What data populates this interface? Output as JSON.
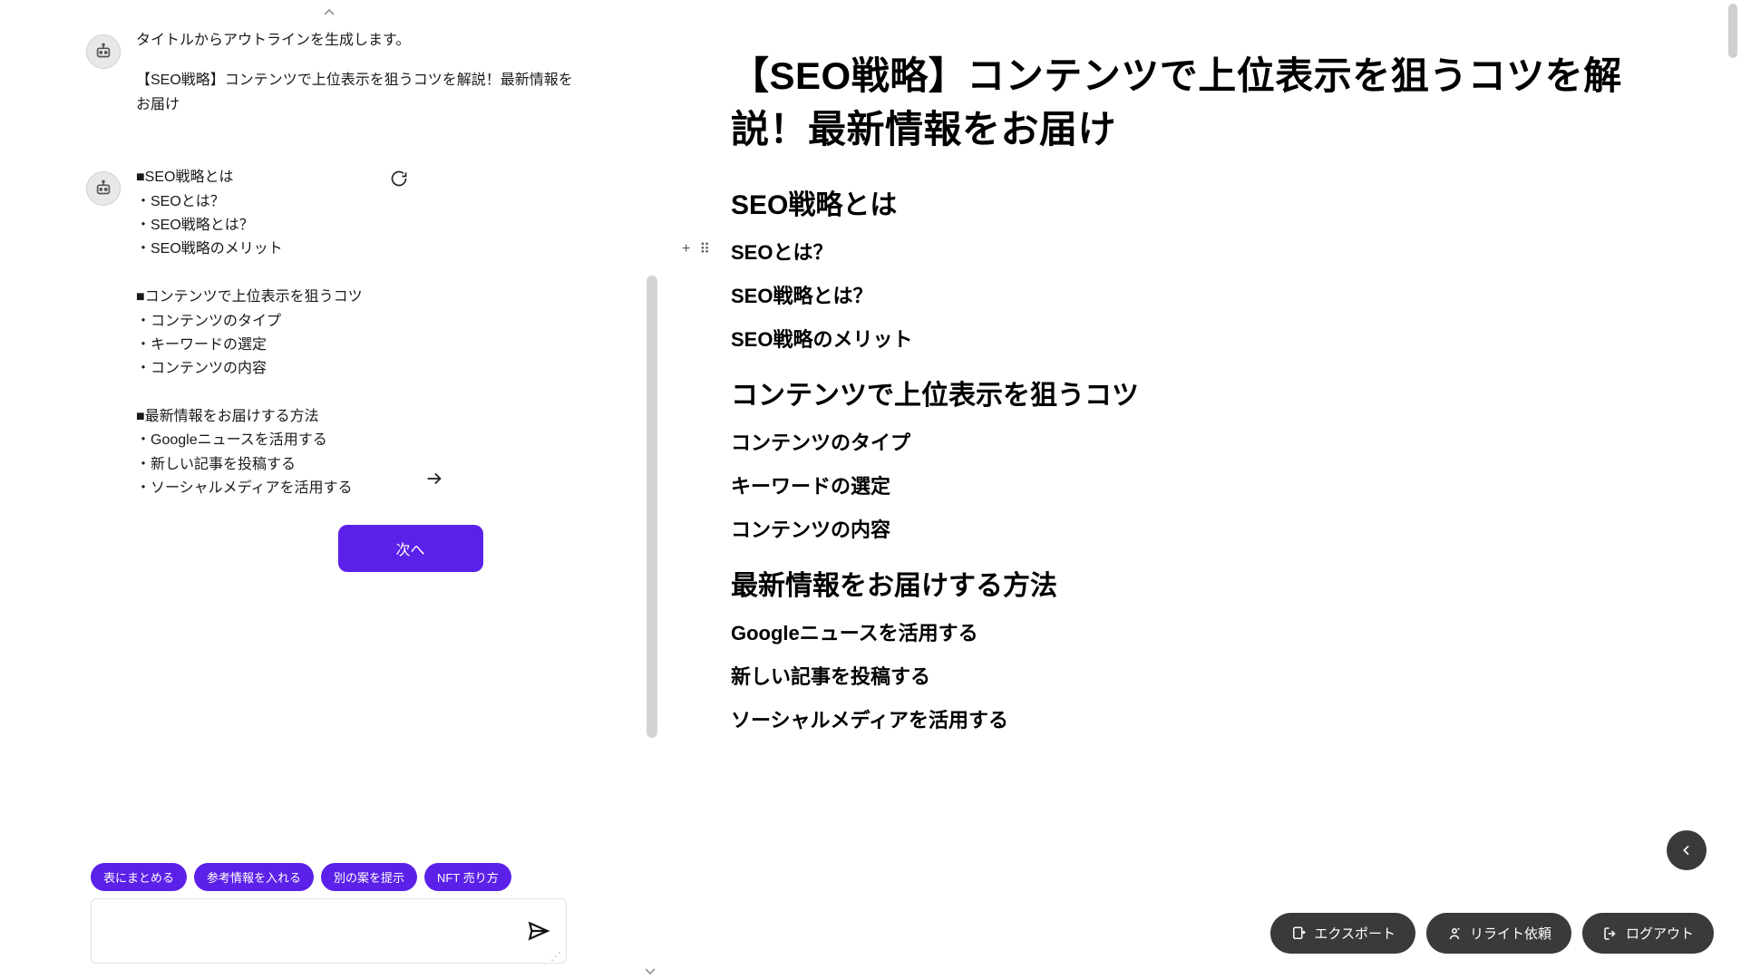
{
  "chat": {
    "messages": [
      {
        "intro": "タイトルからアウトラインを生成します。",
        "title_line": "【SEO戦略】コンテンツで上位表示を狙うコツを解説！最新情報をお届け"
      },
      {
        "outline_text": "■SEO戦略とは\n・SEOとは？\n・SEO戦略とは？\n・SEO戦略のメリット\n\n■コンテンツで上位表示を狙うコツ\n・コンテンツのタイプ\n・キーワードの選定\n・コンテンツの内容\n\n■最新情報をお届けする方法\n・Googleニュースを活用する\n・新しい記事を投稿する\n・ソーシャルメディアを活用する"
      }
    ],
    "next_button": "次へ"
  },
  "chips": [
    "表にまとめる",
    "参考情報を入れる",
    "別の案を提示",
    "NFT 売り方"
  ],
  "input": {
    "placeholder": ""
  },
  "document": {
    "title": "【SEO戦略】コンテンツで上位表示を狙うコツを解説！最新情報をお届け",
    "sections": [
      {
        "h2": "SEO戦略とは",
        "h3": [
          "SEOとは？",
          "SEO戦略とは？",
          "SEO戦略のメリット"
        ]
      },
      {
        "h2": "コンテンツで上位表示を狙うコツ",
        "h3": [
          "コンテンツのタイプ",
          "キーワードの選定",
          "コンテンツの内容"
        ]
      },
      {
        "h2": "最新情報をお届けする方法",
        "h3": [
          "Googleニュースを活用する",
          "新しい記事を投稿する",
          "ソーシャルメディアを活用する"
        ]
      }
    ],
    "active_h3_index": [
      0,
      0
    ]
  },
  "actions": {
    "export": "エクスポート",
    "rewrite": "リライト依頼",
    "logout": "ログアウト"
  },
  "icons": {
    "plus": "+",
    "drag": "⠿"
  }
}
